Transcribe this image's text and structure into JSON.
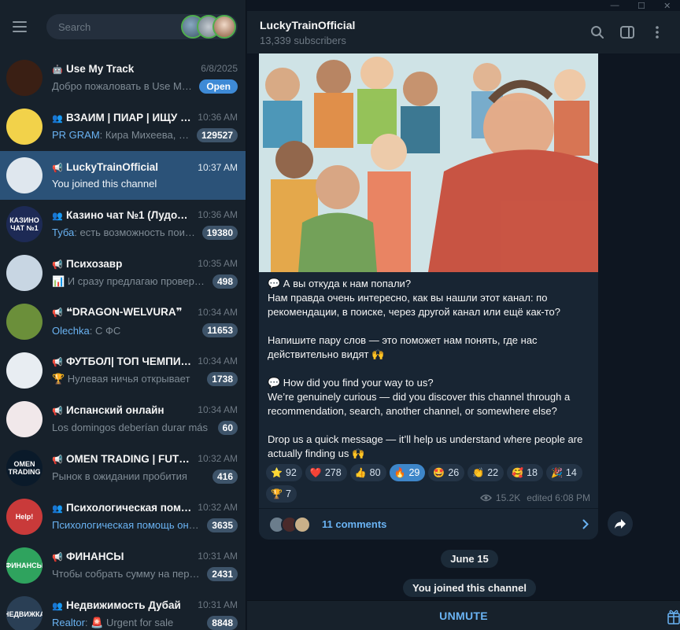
{
  "sidebar": {
    "search_placeholder": "Search",
    "chats": [
      {
        "name": "Use My Track",
        "type_icon": "bot-icon",
        "time": "6/8/2025",
        "preview": "Добро пожаловать в Use My Track...",
        "badge": "Open",
        "avatar_color": "#3a1f14"
      },
      {
        "name": "ВЗАИМ | ПИАР | ИЩУ СПОНСОРА",
        "type_icon": "group-icon",
        "time": "10:36 AM",
        "sender": "PR GRAM",
        "preview": "Кира Михеева, что...",
        "badge": "129527",
        "avatar_color": "#f2d24a"
      },
      {
        "name": "LuckyTrainOfficial",
        "type_icon": "channel-icon",
        "time": "10:37 AM",
        "preview": "You joined this channel",
        "badge": "",
        "avatar_color": "#dfe7ee"
      },
      {
        "name": "Казино чат №1 (Лудоманы)",
        "type_icon": "group-icon",
        "time": "10:36 AM",
        "sender": "Туба",
        "preview": "есть  возможность поиграть",
        "badge": "19380",
        "avatar_color": "#1d2a55",
        "avatar_text": "КАЗИНО ЧАТ №1"
      },
      {
        "name": "Психозавр",
        "type_icon": "channel-icon",
        "time": "10:35 AM",
        "preview": "📊 И сразу предлагаю проверить",
        "badge": "498",
        "avatar_color": "#c8d6e3"
      },
      {
        "name": "❝DRAGON-WELVURA❞",
        "type_icon": "channel-icon",
        "time": "10:34 AM",
        "sender": "Olechka",
        "preview": "С ФС",
        "badge": "11653",
        "avatar_color": "#6b8f3a"
      },
      {
        "name": "ФУТБОЛ| ТОП ЧЕМПИОНАТЫ",
        "type_icon": "channel-icon",
        "time": "10:34 AM",
        "preview": "🏆 Нулевая ничья открывает",
        "badge": "1738",
        "avatar_color": "#e8edf2"
      },
      {
        "name": "Испанский онлайн",
        "type_icon": "channel-icon",
        "time": "10:34 AM",
        "preview": "Los domingos deberían durar más",
        "badge": "60",
        "avatar_color": "#f1e8ea"
      },
      {
        "name": "OMEN TRADING | FUTURES",
        "type_icon": "channel-icon",
        "time": "10:32 AM",
        "preview": "Рынок в ожидании пробития",
        "badge": "416",
        "avatar_color": "#0a1a2a",
        "avatar_text": "OMEN TRADING"
      },
      {
        "name": "Психологическая помощь",
        "type_icon": "group-icon",
        "time": "10:32 AM",
        "sender": "Психологическая помощь онлайн",
        "preview": "",
        "badge": "3635",
        "avatar_color": "#c93a3a",
        "avatar_text": "Help!"
      },
      {
        "name": "ФИНАНСЫ",
        "type_icon": "channel-icon",
        "time": "10:31 AM",
        "preview": "Чтобы собрать сумму на первый",
        "badge": "2431",
        "avatar_color": "#2fa35e",
        "avatar_text": "ФИНАНСЫ"
      },
      {
        "name": "Недвижимость Дубай",
        "type_icon": "group-icon",
        "time": "10:31 AM",
        "sender": "Realtor",
        "preview": "🚨 Urgent for sale",
        "badge": "8848",
        "avatar_color": "#2a3f55",
        "avatar_text": "НЕДВИЖКА"
      }
    ]
  },
  "header": {
    "title": "LuckyTrainOfficial",
    "subtitle": "13,339 subscribers"
  },
  "post": {
    "paragraphs": [
      "💬 А вы откуда к нам попали?\nНам правда очень интересно, как вы нашли этот канал: по рекомендации, в поиске, через другой канал или ещё как-то?",
      "Напишите пару слов — это поможет нам понять, где нас действительно видят 🙌",
      "💬 How did you find your way to us?\nWe’re genuinely curious — did you discover this channel through a recommendation, search, another channel, or somewhere else?",
      "Drop us a quick message — it’ll help us understand where people are actually finding us 🙌"
    ],
    "reactions": [
      {
        "emoji": "⭐",
        "count": "92",
        "mine": false
      },
      {
        "emoji": "❤️",
        "count": "278",
        "mine": false
      },
      {
        "emoji": "👍",
        "count": "80",
        "mine": false
      },
      {
        "emoji": "🔥",
        "count": "29",
        "mine": true
      },
      {
        "emoji": "🤩",
        "count": "26",
        "mine": false
      },
      {
        "emoji": "👏",
        "count": "22",
        "mine": false
      },
      {
        "emoji": "🥰",
        "count": "18",
        "mine": false
      },
      {
        "emoji": "🎉",
        "count": "14",
        "mine": false
      },
      {
        "emoji": "🏆",
        "count": "7",
        "mine": false
      }
    ],
    "views": "15.2K",
    "edited": "edited 6:08 PM",
    "comments_label": "11 comments"
  },
  "service": {
    "date": "June 15",
    "joined": "You joined this channel"
  },
  "bottom": {
    "unmute_label": "UNMUTE"
  }
}
